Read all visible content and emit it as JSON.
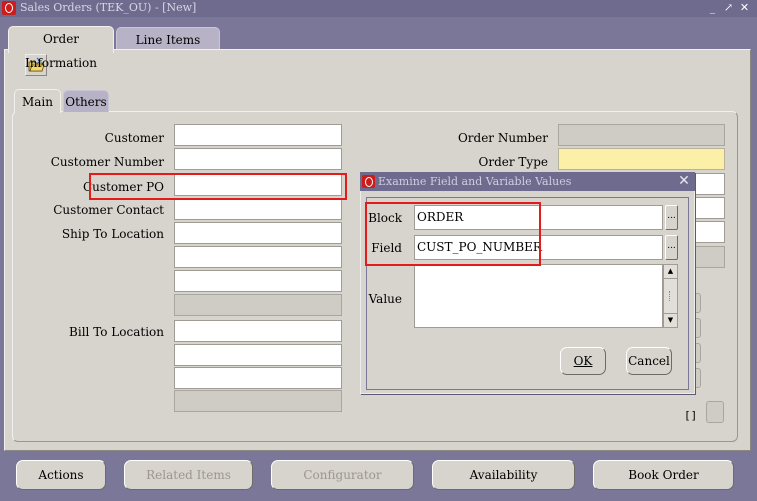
{
  "window": {
    "title": "Sales Orders (TEK_OU) - [New]",
    "controls": [
      "_",
      "↗",
      "✕"
    ]
  },
  "tabs": [
    {
      "label": "Order Information"
    },
    {
      "label": "Line Items"
    }
  ],
  "subtabs": [
    {
      "label": "Main"
    },
    {
      "label": "Others"
    }
  ],
  "left_fields": {
    "customer": "Customer",
    "customer_number": "Customer Number",
    "customer_po": "Customer PO",
    "customer_contact": "Customer Contact",
    "ship_to": "Ship To Location",
    "bill_to": "Bill To Location"
  },
  "right_fields": {
    "order_number": "Order Number",
    "order_type": "Order Type"
  },
  "bracket": "[]",
  "dialog": {
    "title": "Examine Field and Variable Values",
    "block_label": "Block",
    "block_value": "ORDER",
    "field_label": "Field",
    "field_value": "CUST_PO_NUMBER",
    "value_label": "Value",
    "value_text": "",
    "lov": "...",
    "ok": "OK",
    "cancel": "Cancel"
  },
  "buttons": [
    {
      "label": "Actions"
    },
    {
      "label": "Related Items"
    },
    {
      "label": "Configurator"
    },
    {
      "label": "Availability"
    },
    {
      "label": "Book Order"
    }
  ]
}
